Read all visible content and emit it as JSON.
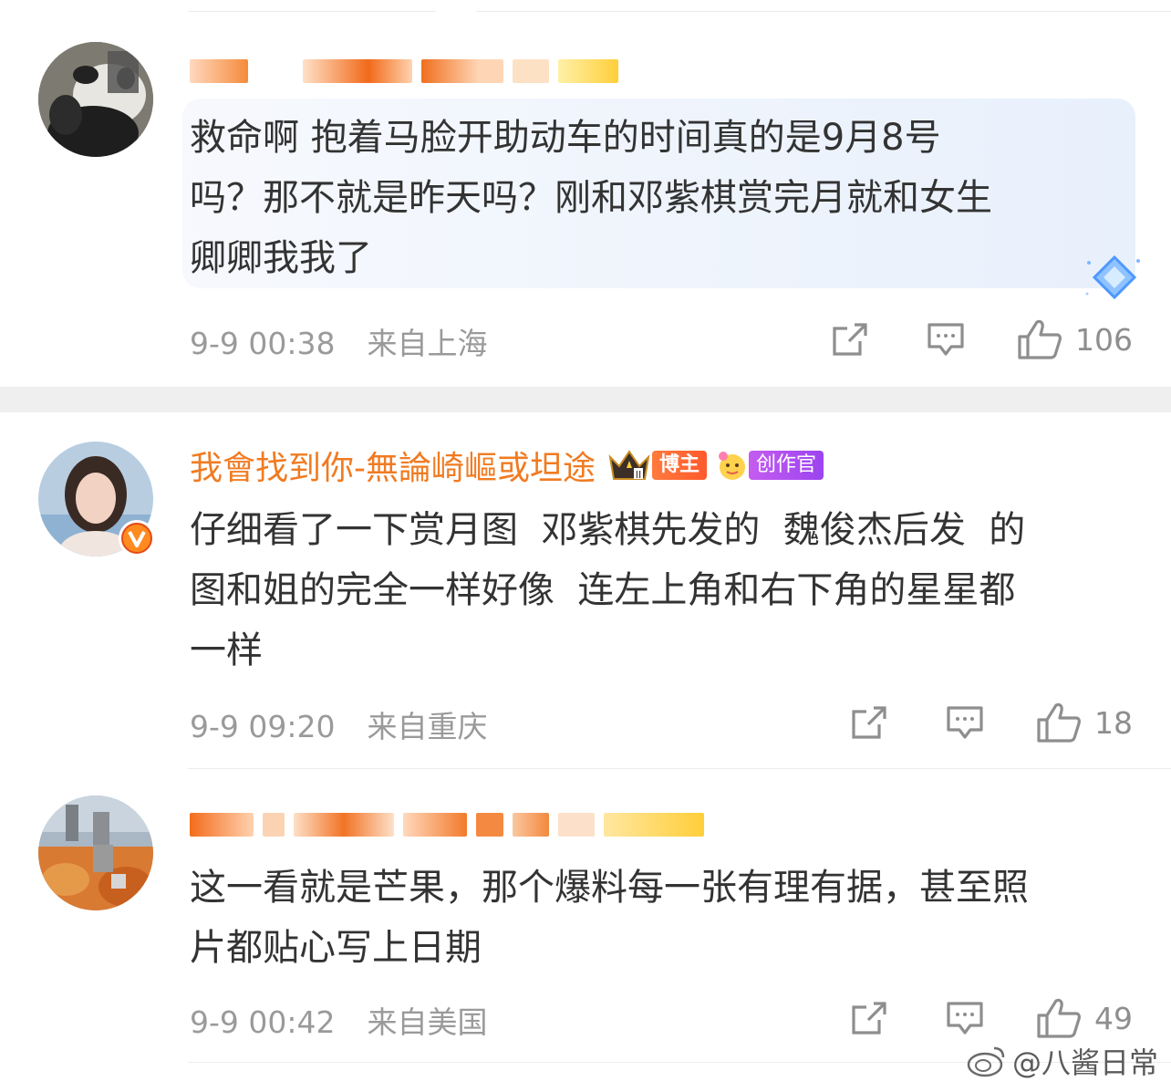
{
  "comments": [
    {
      "username": "",
      "badge": "",
      "text": "救命啊 抱着马脸开助动车的时间真的是9月8号\n吗？那不就是昨天吗？刚和邓紫棋赏完月就和女生\n卿卿我我了",
      "timestamp": "9-9 00:38",
      "location": "来自上海",
      "likes": "106"
    },
    {
      "username": "我會找到你-無論崎嶇或坦途",
      "vip_label": "博主",
      "creator_label": "创作官",
      "text": "仔细看了一下赏月图  邓紫棋先发的  魏俊杰后发  的\n图和姐的完全一样好像  连左上角和右下角的星星都\n一样",
      "timestamp": "9-9 09:20",
      "location": "来自重庆",
      "likes": "18"
    },
    {
      "username": "",
      "badge": "",
      "text": "这一看就是芒果，那个爆料每一张有理有据，甚至照\n片都贴心写上日期",
      "timestamp": "9-9 00:42",
      "location": "来自美国",
      "likes": "49"
    }
  ],
  "watermark": "@八酱日常",
  "colors": {
    "username_orange": "#f07b22",
    "meta_gray": "#9a9a9a",
    "text": "#333333"
  },
  "icons": [
    "share-icon",
    "comment-icon",
    "like-icon",
    "weibo-logo-icon",
    "diamond-icon"
  ]
}
